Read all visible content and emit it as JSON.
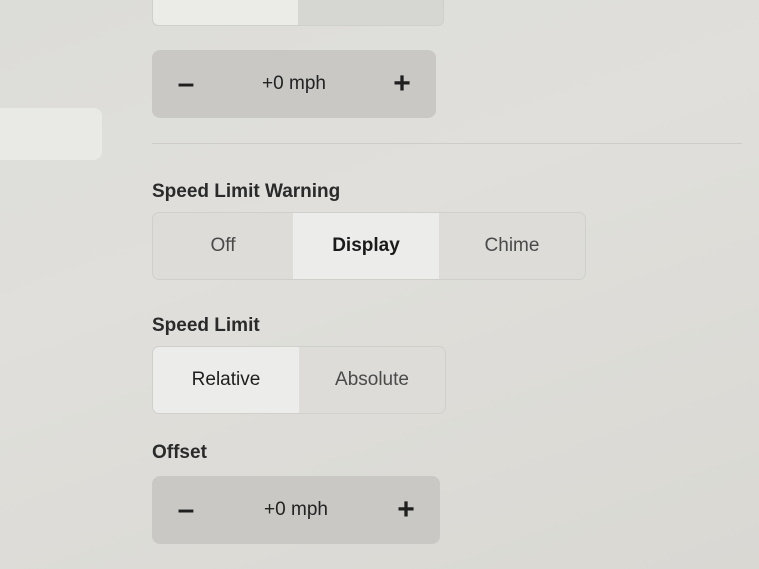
{
  "top_stepper": {
    "minus": "–",
    "value": "+0 mph",
    "plus": "+"
  },
  "speed_limit_warning": {
    "title": "Speed Limit Warning",
    "options": [
      "Off",
      "Display",
      "Chime"
    ],
    "selected": "Display"
  },
  "speed_limit": {
    "title": "Speed Limit",
    "options": [
      "Relative",
      "Absolute"
    ],
    "selected": "Relative"
  },
  "offset": {
    "title": "Offset",
    "minus": "–",
    "value": "+0 mph",
    "plus": "+"
  }
}
